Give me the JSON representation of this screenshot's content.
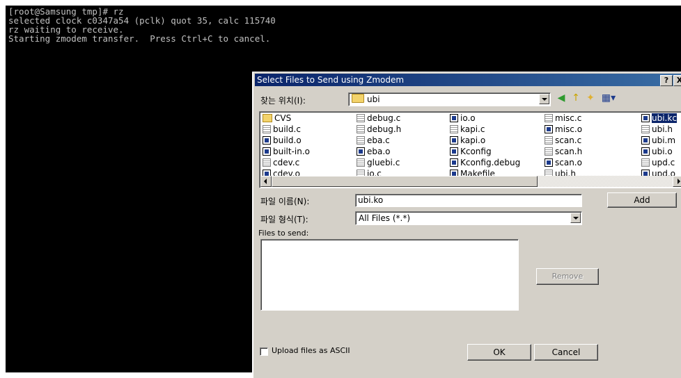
{
  "terminal": {
    "lines": [
      "[root@Samsung tmp]# rz",
      "selected clock c0347a54 (pclk) quot 35, calc 115740",
      "rz waiting to receive.",
      "Starting zmodem transfer.  Press Ctrl+C to cancel."
    ]
  },
  "dialog": {
    "title": "Select Files to Send using Zmodem",
    "help_label": "?",
    "close_label": "X",
    "look_in_label": "찾는 위치(I):",
    "look_in_value": "ubi",
    "files": [
      {
        "name": "CVS",
        "type": "folder"
      },
      {
        "name": "build.c",
        "type": "doc"
      },
      {
        "name": "build.o",
        "type": "bin"
      },
      {
        "name": "built-in.o",
        "type": "bin"
      },
      {
        "name": "cdev.c",
        "type": "doc"
      },
      {
        "name": "cdev.o",
        "type": "bin"
      },
      {
        "name": "debug.c",
        "type": "doc"
      },
      {
        "name": "debug.h",
        "type": "doc"
      },
      {
        "name": "eba.c",
        "type": "doc"
      },
      {
        "name": "eba.o",
        "type": "bin"
      },
      {
        "name": "gluebi.c",
        "type": "doc"
      },
      {
        "name": "io.c",
        "type": "doc"
      },
      {
        "name": "io.o",
        "type": "bin"
      },
      {
        "name": "kapi.c",
        "type": "doc"
      },
      {
        "name": "kapi.o",
        "type": "bin"
      },
      {
        "name": "Kconfig",
        "type": "bin"
      },
      {
        "name": "Kconfig.debug",
        "type": "bin"
      },
      {
        "name": "Makefile",
        "type": "bin"
      },
      {
        "name": "misc.c",
        "type": "doc"
      },
      {
        "name": "misc.o",
        "type": "bin"
      },
      {
        "name": "scan.c",
        "type": "doc"
      },
      {
        "name": "scan.h",
        "type": "doc"
      },
      {
        "name": "scan.o",
        "type": "bin"
      },
      {
        "name": "ubi.h",
        "type": "doc"
      },
      {
        "name": "ubi.kc",
        "type": "bin",
        "selected": true
      },
      {
        "name": "ubi.h",
        "type": "doc"
      },
      {
        "name": "ubi.m",
        "type": "bin"
      },
      {
        "name": "ubi.o",
        "type": "bin"
      },
      {
        "name": "upd.c",
        "type": "doc"
      },
      {
        "name": "upd.o",
        "type": "bin"
      }
    ],
    "filename_label": "파일 이름(N):",
    "filename_value": "ubi.ko",
    "add_label": "Add",
    "filetype_label": "파일 형식(T):",
    "filetype_value": "All Files (*.*)",
    "files_to_send_label": "Files to send:",
    "remove_label": "Remove",
    "ascii_label": "Upload files as ASCII",
    "ok_label": "OK",
    "cancel_label": "Cancel"
  }
}
